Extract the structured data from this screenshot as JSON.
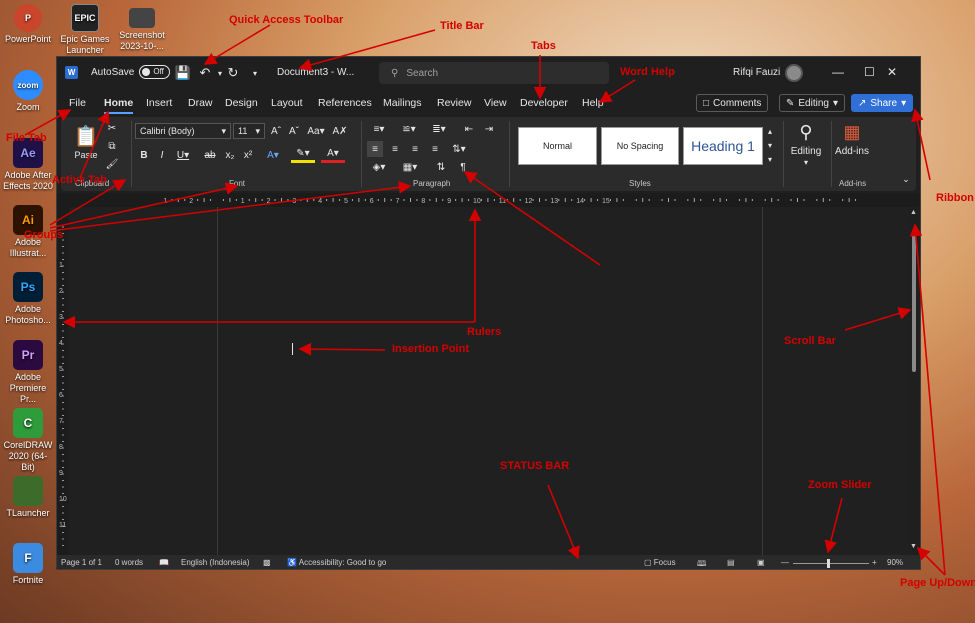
{
  "desktop": {
    "top_icons": [
      {
        "label": "PowerPoint",
        "glyph": "P",
        "color": "#c9452b"
      },
      {
        "label": "Epic Games Launcher",
        "glyph": "EPIC",
        "color": "#222222"
      },
      {
        "label": "Screenshot 2023-10-...",
        "glyph": "",
        "color": "#444444"
      }
    ],
    "side_icons": [
      {
        "label": "Zoom",
        "glyph": "zoom",
        "color": "#2d8cff"
      },
      {
        "label": "Adobe After Effects 2020",
        "glyph": "Ae",
        "color": "#1f1147"
      },
      {
        "label": "Adobe Illustrat...",
        "glyph": "Ai",
        "color": "#2e1200"
      },
      {
        "label": "Adobe Photosho...",
        "glyph": "Ps",
        "color": "#001e36"
      },
      {
        "label": "Adobe Premiere Pr...",
        "glyph": "Pr",
        "color": "#2a0a3f"
      },
      {
        "label": "CorelDRAW 2020 (64-Bit)",
        "glyph": "C",
        "color": "#2e9c3a"
      },
      {
        "label": "TLauncher",
        "glyph": "",
        "color": "#3d6b2a"
      },
      {
        "label": "Fortnite",
        "glyph": "F",
        "color": "#3b8be0"
      }
    ]
  },
  "titlebar": {
    "autosave_label": "AutoSave",
    "autosave_state": "Off",
    "document": "Document3  -  W...",
    "search_placeholder": "Search",
    "user": "Rifqi Fauzi"
  },
  "tabs": [
    "File",
    "Home",
    "Insert",
    "Draw",
    "Design",
    "Layout",
    "References",
    "Mailings",
    "Review",
    "View",
    "Developer",
    "Help"
  ],
  "actions": {
    "comments": "Comments",
    "editing": "Editing",
    "share": "Share"
  },
  "ribbon": {
    "clipboard": {
      "paste": "Paste",
      "label": "Clipboard"
    },
    "font": {
      "family": "Calibri (Body)",
      "size": "11",
      "label": "Font"
    },
    "paragraph": {
      "label": "Paragraph"
    },
    "styles": {
      "items": [
        "Normal",
        "No Spacing",
        "Heading 1"
      ],
      "label": "Styles"
    },
    "editing": {
      "label": "Editing"
    },
    "addins": {
      "button": "Add-ins",
      "label": "Add-ins"
    }
  },
  "ruler_numbers": [
    "1",
    "2",
    "1",
    "2",
    "3",
    "4",
    "5",
    "6",
    "7",
    "8",
    "9",
    "10",
    "11",
    "12",
    "13",
    "14",
    "15"
  ],
  "ruler_v_numbers": [
    "1",
    "2",
    "3",
    "4",
    "5",
    "6",
    "7",
    "8",
    "9",
    "10",
    "11"
  ],
  "status": {
    "page": "Page 1 of 1",
    "words": "0 words",
    "language": "English (Indonesia)",
    "accessibility": "Accessibility: Good to go",
    "focus": "Focus",
    "zoom": "90%"
  },
  "annotations": {
    "quick_access": "Quick Access Toolbar",
    "title_bar": "Title Bar",
    "tabs": "Tabs",
    "word_help": "Word Help",
    "file_tab": "File Tab",
    "active_tab": "Active Tab",
    "groups": "Groups",
    "ribbon": "Ribbon",
    "rulers": "Rulers",
    "insertion_point": "Insertion Point",
    "scroll_bar": "Scroll Bar",
    "status_bar": "STATUS BAR",
    "zoom_slider": "Zoom Slider",
    "page_updown": "Page Up/Down"
  }
}
